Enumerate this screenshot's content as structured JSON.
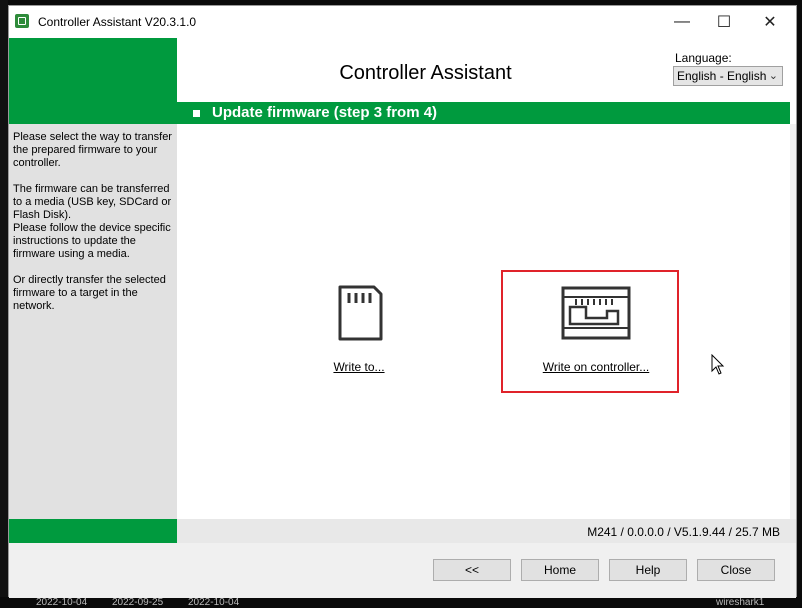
{
  "desktop": {
    "dates_top": "2022-10-04    2022-09-25    2022-10-04",
    "dates_bottom": [
      "2022-10-04",
      "2022-09-25",
      "2022-10-04"
    ],
    "taskbar_right": "wireshark1"
  },
  "window": {
    "title": "Controller Assistant V20.3.1.0",
    "min_glyph": "—",
    "max_glyph": "☐",
    "close_glyph": "✕"
  },
  "header": {
    "title": "Controller Assistant",
    "language_label": "Language:",
    "language_value": "English - English"
  },
  "step": {
    "title": "Update firmware (step 3 from 4)"
  },
  "side": {
    "paragraphs": [
      "Please select the way to transfer the prepared firmware to your controller.",
      "The firmware can be transferred to a media (USB key, SDCard or Flash Disk).",
      "Please follow the device specific instructions to update the firmware using a media.",
      "Or directly transfer the selected firmware to a target in the network."
    ]
  },
  "options": {
    "media_label": "Write to...",
    "controller_label": "Write on controller...",
    "media_icon": "sdcard-icon",
    "controller_icon": "controller-icon"
  },
  "status": {
    "text": "M241 / 0.0.0.0 / V5.1.9.44 / 25.7 MB"
  },
  "buttons": {
    "back": "<<",
    "home": "Home",
    "help": "Help",
    "close": "Close"
  },
  "colors": {
    "brand_green": "#009a3e",
    "highlight_red": "#e0232a"
  }
}
